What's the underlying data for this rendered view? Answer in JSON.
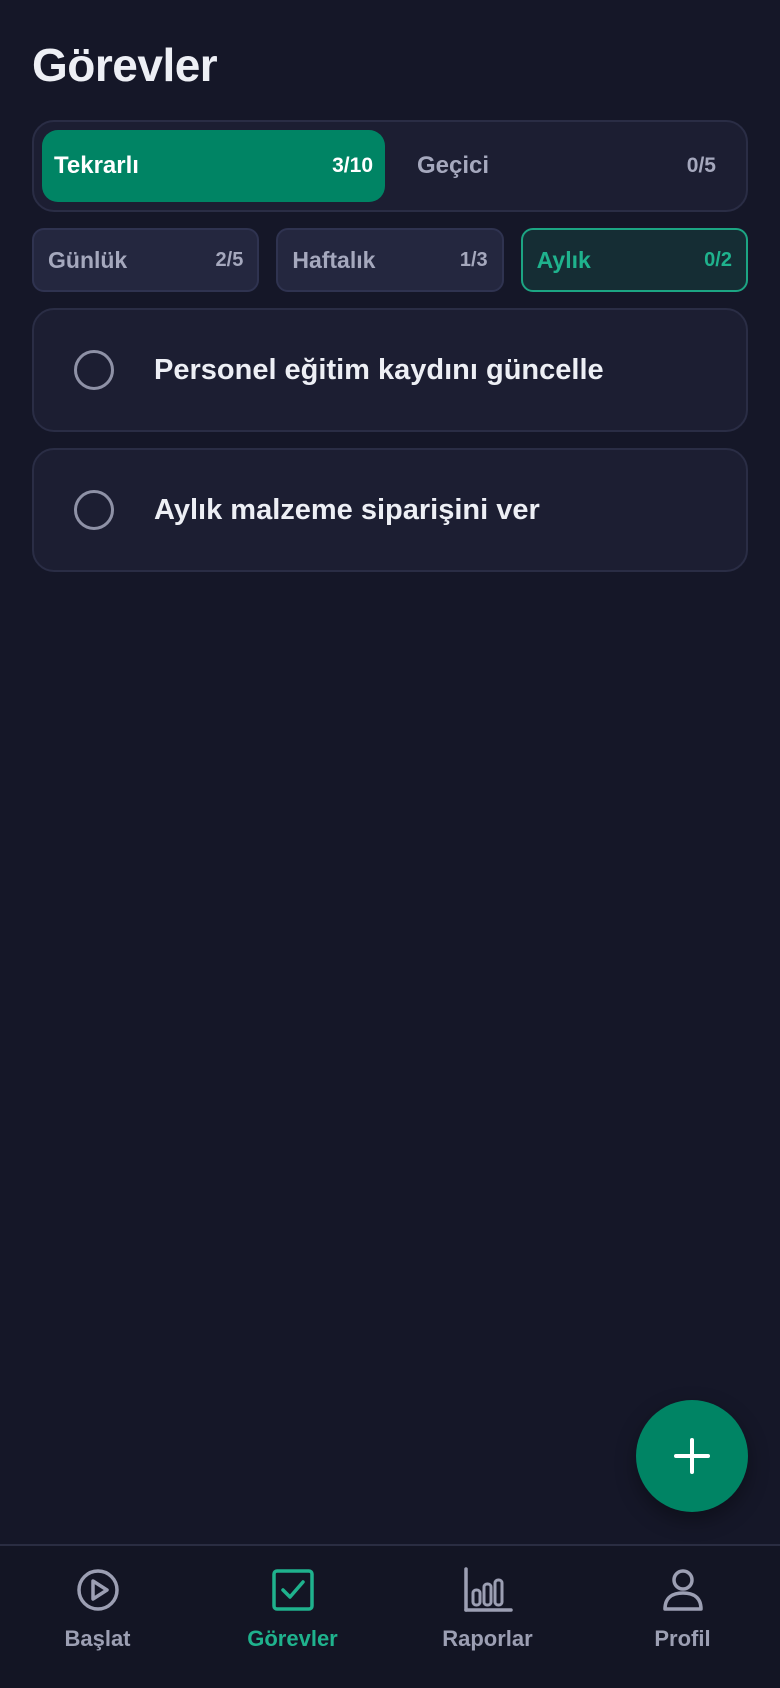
{
  "header": {
    "title": "Görevler"
  },
  "type_segment": [
    {
      "label": "Tekrarlı",
      "count": "3/10",
      "active": true
    },
    {
      "label": "Geçici",
      "count": "0/5",
      "active": false
    }
  ],
  "period_chips": [
    {
      "label": "Günlük",
      "count": "2/5",
      "active": false
    },
    {
      "label": "Haftalık",
      "count": "1/3",
      "active": false
    },
    {
      "label": "Aylık",
      "count": "0/2",
      "active": true
    }
  ],
  "tasks": [
    {
      "title": "Personel eğitim kaydını güncelle",
      "done": false
    },
    {
      "title": "Aylık malzeme siparişini ver",
      "done": false
    }
  ],
  "fab": {
    "icon": "plus-icon"
  },
  "bottom_nav": [
    {
      "label": "Başlat",
      "icon": "play-circle-icon",
      "active": false
    },
    {
      "label": "Görevler",
      "icon": "checkbox-icon",
      "active": true
    },
    {
      "label": "Raporlar",
      "icon": "bar-chart-icon",
      "active": false
    },
    {
      "label": "Profil",
      "icon": "person-icon",
      "active": false
    }
  ],
  "colors": {
    "background": "#151728",
    "accent": "#008464",
    "accent_text": "#1FB28D",
    "card": "#1C1E32",
    "muted_text": "#A5A8BD"
  }
}
